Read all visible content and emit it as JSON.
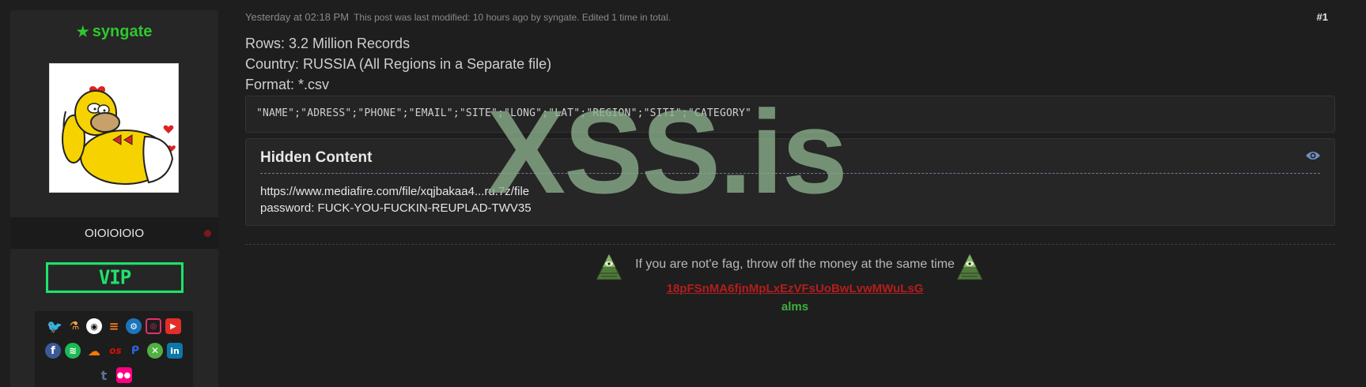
{
  "user": {
    "name": "syngate",
    "title": "OIOIOIOIO",
    "badge": "VIP",
    "avatar_desc": "homer-simpson-avatar"
  },
  "socials": {
    "row1": [
      "twitter-icon",
      "dns-icon",
      "github-icon",
      "stackoverflow-icon",
      "steam-icon",
      "instagram-icon",
      "youtube-icon"
    ],
    "row2": [
      "facebook-icon",
      "spotify-icon",
      "soundcloud-icon",
      "lastfm-icon",
      "playstation-icon",
      "xbox-icon",
      "linkedin-icon"
    ],
    "row3": [
      "tumblr-icon",
      "flickr-icon"
    ]
  },
  "post": {
    "date": "Yesterday at 02:18 PM",
    "edit_note": "This post was last modified: 10 hours ago by syngate. Edited 1 time in total.",
    "number": "#1",
    "lines": [
      "Rows: 3.2 Million Records",
      "Country: RUSSIA (All Regions in a Separate file)",
      "Format: *.csv"
    ],
    "code": "\"NAME\";\"ADRESS\";\"PHONE\";\"EMAIL\";\"SITE\";\"LONG\";\"LAT\";\"REGION\";\"SITI\";\"CATEGORY\"",
    "hidden": {
      "title": "Hidden Content",
      "link": "https://www.mediafire.com/file/xqjbakaa4...ru.7z/file",
      "password": "password: FUCK-YOU-FUCKIN-REUPLAD-TWV35"
    }
  },
  "watermark": "XSS.is",
  "signature": {
    "text": "If you are not'e fag, throw off the money at the same time",
    "wallet": "18pFSnMA6fjnMpLxEzVFsUoBwLvwMWuLsG",
    "alms": "alms"
  },
  "colors": {
    "username": "#2ec72e",
    "vip": "#1fe36b",
    "wallet": "#b31d1d",
    "alms": "#3fae3f"
  }
}
